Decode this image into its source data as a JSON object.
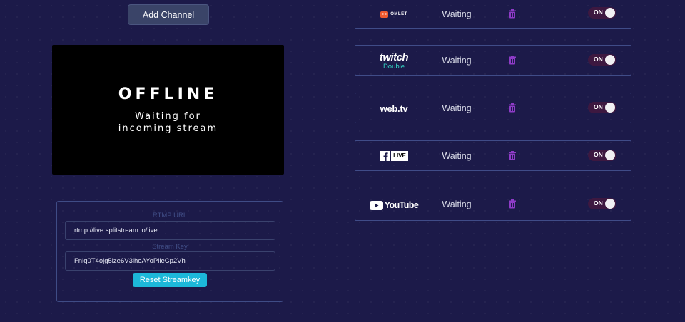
{
  "toolbar": {
    "add_channel_label": "Add Channel"
  },
  "preview": {
    "title": "OFFLINE",
    "subtitle": "Waiting for\nincoming stream"
  },
  "rtmp": {
    "url_label": "RTMP URL",
    "url_value": "rtmp://live.splitstream.io/live",
    "key_label": "Stream Key",
    "key_value": "Fnlq0T4ojg5lze6V3lhoAYoPlleCp2Vh",
    "reset_label": "Reset Streamkey"
  },
  "channels": [
    {
      "logo": "omlet-logo",
      "logo_text": "OMLET",
      "status": "Waiting",
      "toggle_label": "ON",
      "enabled": true
    },
    {
      "logo": "twitch-logo",
      "logo_text": "twitch",
      "logo_sub": "Double",
      "status": "Waiting",
      "toggle_label": "ON",
      "enabled": true
    },
    {
      "logo": "webtv-logo",
      "logo_text": "web.tv",
      "status": "Waiting",
      "toggle_label": "ON",
      "enabled": true
    },
    {
      "logo": "facebook-live-logo",
      "logo_text": "LIVE",
      "status": "Waiting",
      "toggle_label": "ON",
      "enabled": true
    },
    {
      "logo": "youtube-logo",
      "logo_text": "YouTube",
      "status": "Waiting",
      "toggle_label": "ON",
      "enabled": true
    }
  ],
  "colors": {
    "background": "#1c1a49",
    "accent": "#1cb8d9",
    "trash": "#8e3bc7",
    "border": "#404c88"
  }
}
